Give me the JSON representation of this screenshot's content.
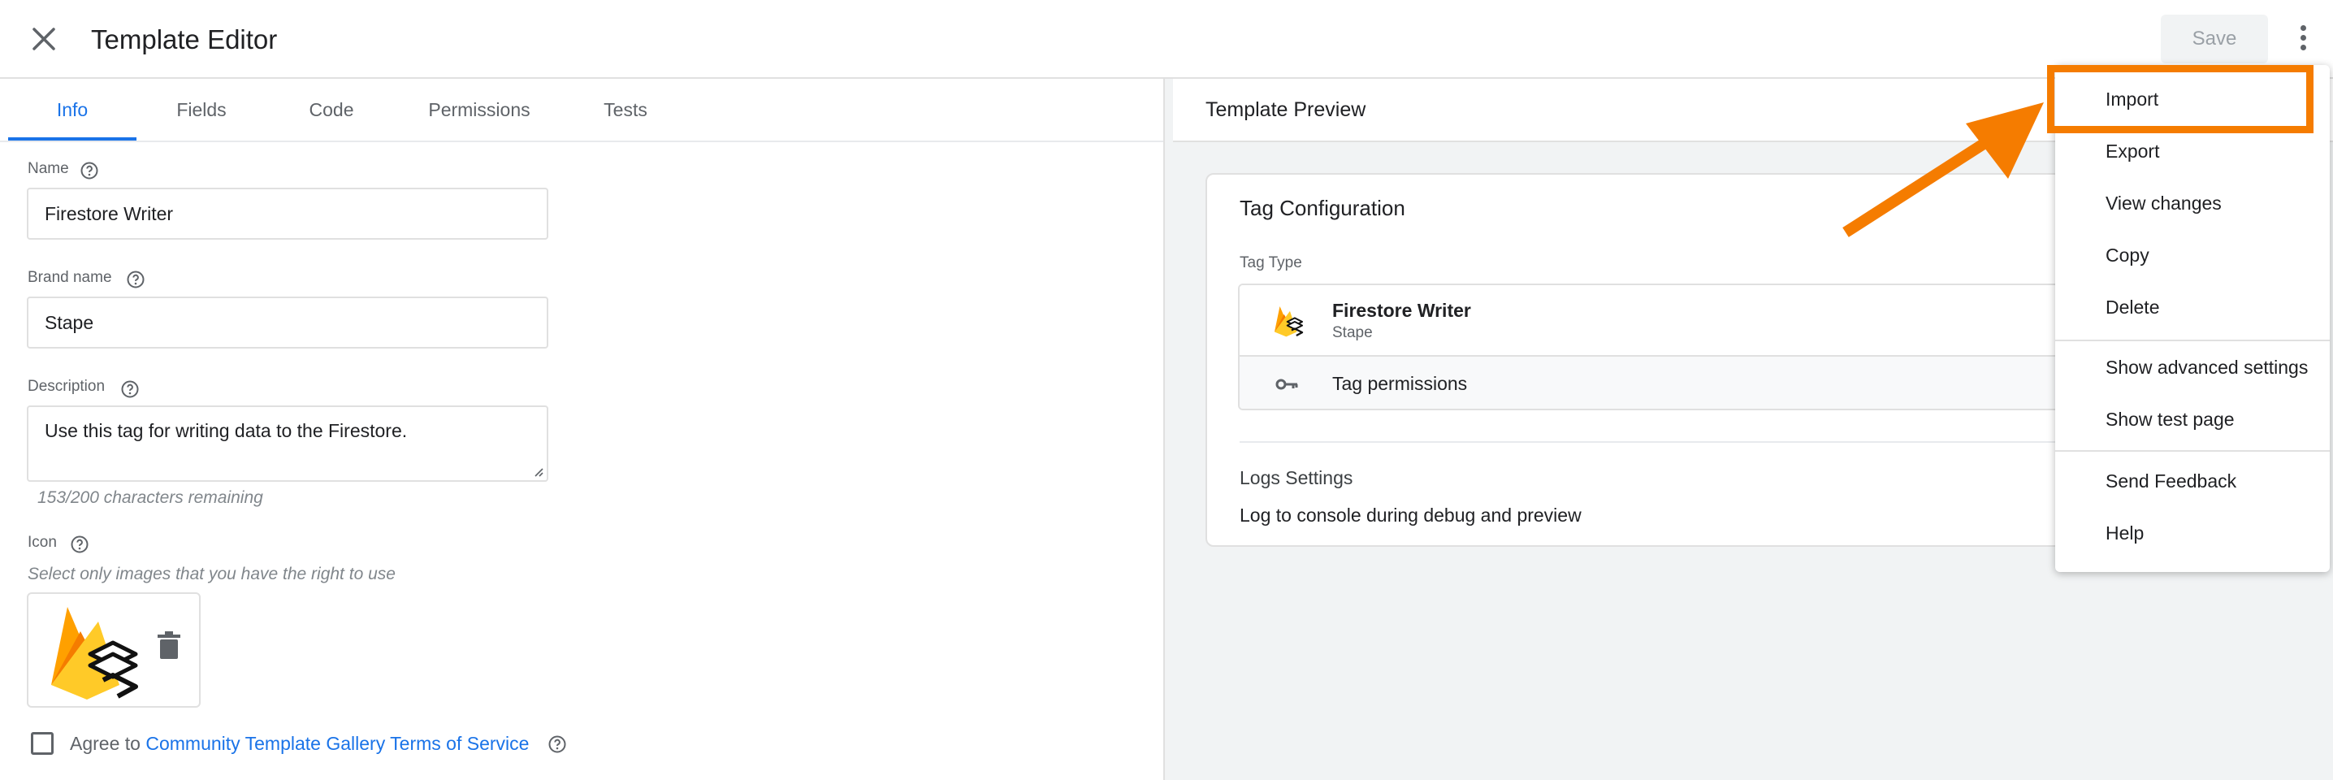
{
  "header": {
    "title": "Template Editor",
    "save_label": "Save"
  },
  "tabs": [
    {
      "label": "Info",
      "active": true
    },
    {
      "label": "Fields",
      "active": false
    },
    {
      "label": "Code",
      "active": false
    },
    {
      "label": "Permissions",
      "active": false
    },
    {
      "label": "Tests",
      "active": false
    }
  ],
  "info": {
    "name_label": "Name",
    "name_value": "Firestore Writer",
    "brand_label": "Brand name",
    "brand_value": "Stape",
    "description_label": "Description",
    "description_value": "Use this tag for writing data to the Firestore.",
    "chars_remaining": "153/200 characters remaining",
    "icon_label": "Icon",
    "icon_hint": "Select only images that you have the right to use",
    "agree_prefix": "Agree to ",
    "agree_link": "Community Template Gallery Terms of Service"
  },
  "preview": {
    "title": "Template Preview",
    "card_title": "Tag Configuration",
    "tag_type_label": "Tag Type",
    "tag_name": "Firestore Writer",
    "tag_brand": "Stape",
    "tag_permissions": "Tag permissions",
    "logs_title": "Logs Settings",
    "logs_value": "Log to console during debug and preview"
  },
  "menu": {
    "items": [
      {
        "label": "Import"
      },
      {
        "label": "Export"
      },
      {
        "label": "View changes"
      },
      {
        "label": "Copy"
      },
      {
        "label": "Delete"
      },
      {
        "label": "Show advanced settings"
      },
      {
        "label": "Show test page"
      },
      {
        "label": "Send Feedback"
      },
      {
        "label": "Help"
      }
    ]
  },
  "colors": {
    "accent": "#1a73e8",
    "highlight": "#f57c00",
    "firebase_yellow": "#ffca28",
    "firebase_orange": "#f57c00"
  },
  "icons": [
    "close-icon",
    "more-vert-icon",
    "help-icon",
    "trash-icon",
    "key-icon",
    "firebase-stape-logo",
    "arrow-annotation"
  ]
}
